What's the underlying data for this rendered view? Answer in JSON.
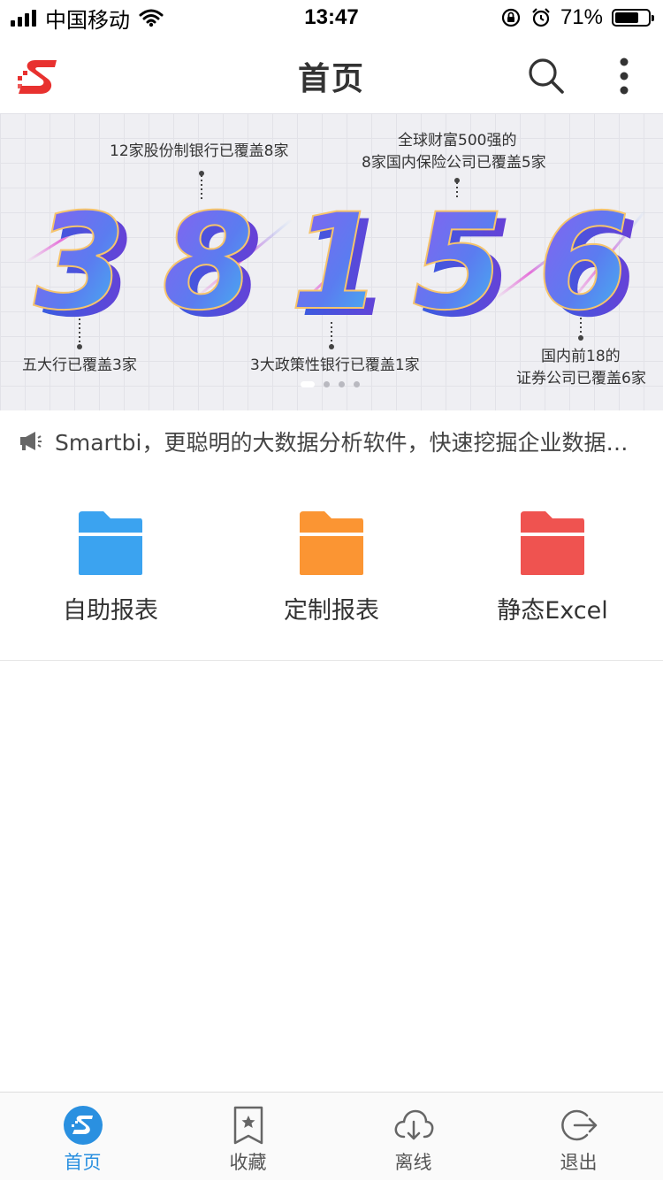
{
  "status_bar": {
    "carrier": "中国移动",
    "time": "13:47",
    "battery_percent": "71%",
    "battery_level": 0.71
  },
  "header": {
    "title": "首页",
    "logo_icon": "smartbi-logo",
    "search_icon": "search-icon",
    "more_icon": "more-vertical-icon"
  },
  "banner": {
    "digits": [
      "3",
      "8",
      "1",
      "5",
      "6"
    ],
    "captions": {
      "c1": "12家股份制银行已覆盖8家",
      "c2a": "全球财富500强的",
      "c2b": "8家国内保险公司已覆盖5家",
      "c3": "五大行已覆盖3家",
      "c4": "3大政策性银行已覆盖1家",
      "c5a": "国内前18的",
      "c5b": "证券公司已覆盖6家"
    },
    "page_count": 4,
    "active_page": 1
  },
  "notice": {
    "icon": "megaphone-icon",
    "text": "Smartbi，更聪明的大数据分析软件，快速挖掘企业数据价值"
  },
  "shortcuts": [
    {
      "label": "自助报表",
      "icon": "folder-icon",
      "color": "#3ba3f0"
    },
    {
      "label": "定制报表",
      "icon": "folder-icon",
      "color": "#fb9533"
    },
    {
      "label": "静态Excel",
      "icon": "folder-icon",
      "color": "#ef5350"
    }
  ],
  "tabs": [
    {
      "label": "首页",
      "icon": "home-logo-icon",
      "active": true
    },
    {
      "label": "收藏",
      "icon": "bookmark-icon",
      "active": false
    },
    {
      "label": "离线",
      "icon": "cloud-download-icon",
      "active": false
    },
    {
      "label": "退出",
      "icon": "logout-icon",
      "active": false
    }
  ],
  "colors": {
    "accent": "#2a90e0",
    "brand_red": "#e8312f"
  }
}
